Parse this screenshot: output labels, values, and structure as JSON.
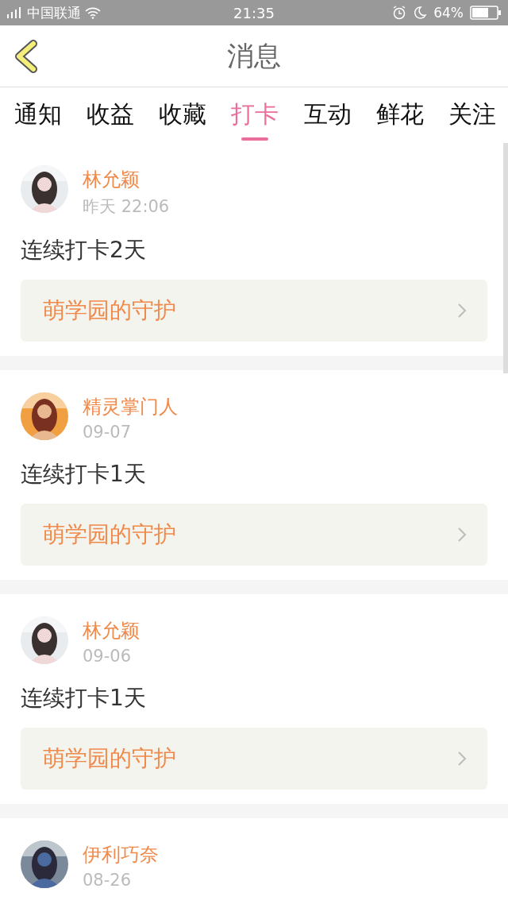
{
  "status_bar": {
    "carrier": "中国联通",
    "time": "21:35",
    "battery": "64%"
  },
  "header": {
    "title": "消息"
  },
  "tabs": [
    {
      "label": "通知",
      "selected": false
    },
    {
      "label": "收益",
      "selected": false
    },
    {
      "label": "收藏",
      "selected": false
    },
    {
      "label": "打卡",
      "selected": true
    },
    {
      "label": "互动",
      "selected": false
    },
    {
      "label": "鲜花",
      "selected": false
    },
    {
      "label": "关注",
      "selected": false
    }
  ],
  "messages": [
    {
      "name": "林允颖",
      "time": "昨天 22:06",
      "text": "连续打卡2天",
      "link": "萌学园的守护"
    },
    {
      "name": "精灵掌门人",
      "time": "09-07",
      "text": "连续打卡1天",
      "link": "萌学园的守护"
    },
    {
      "name": "林允颖",
      "time": "09-06",
      "text": "连续打卡1天",
      "link": "萌学园的守护"
    },
    {
      "name": "伊利巧奈",
      "time": "08-26"
    }
  ]
}
